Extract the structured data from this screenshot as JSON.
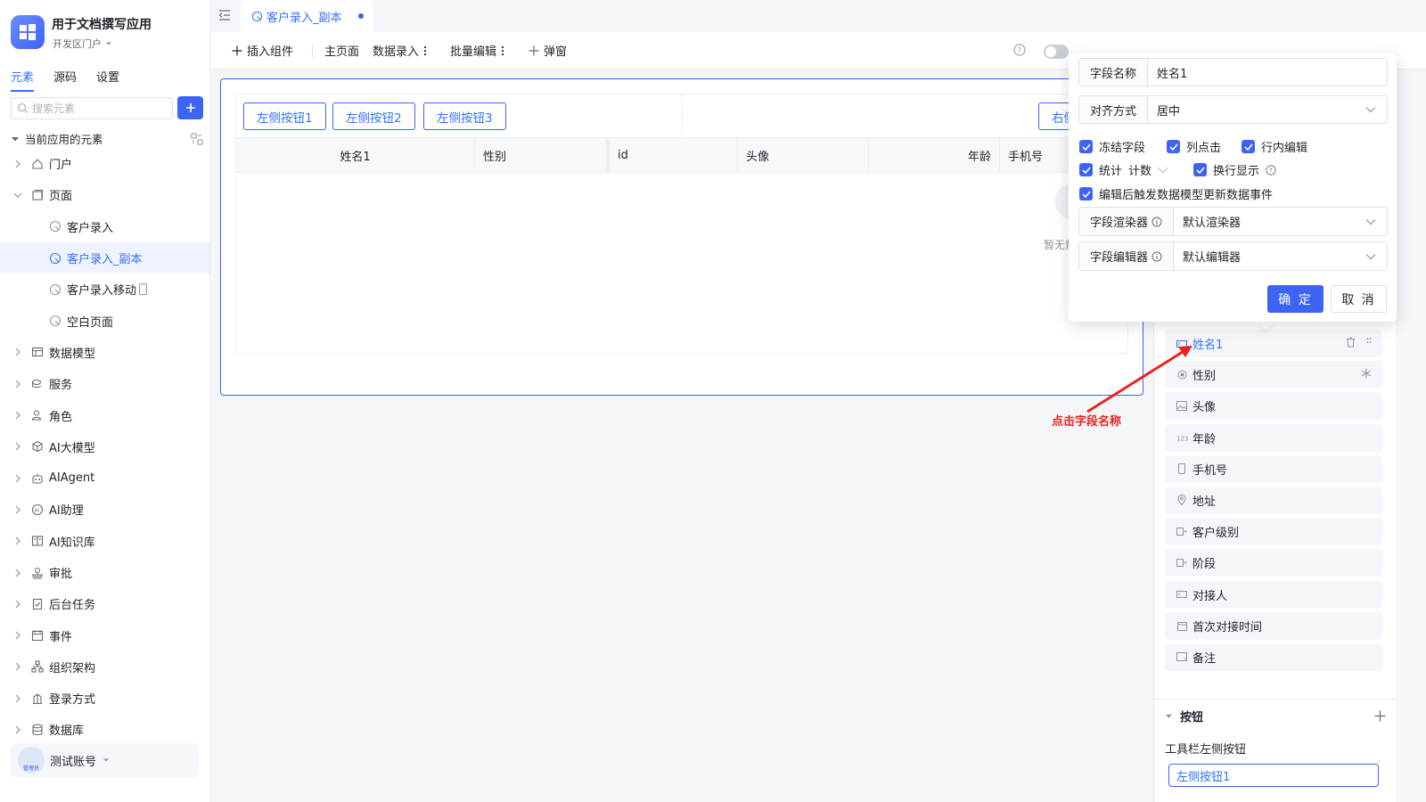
{
  "app": {
    "name": "用于文档撰写应用",
    "portal": "开发区门户"
  },
  "sidebar": {
    "tabs": [
      "元素",
      "源码",
      "设置"
    ],
    "search_placeholder": "搜索元素",
    "tree_header": "当前应用的元素",
    "items": [
      {
        "label": "门户",
        "icon": "home-icon"
      },
      {
        "label": "页面",
        "icon": "page-icon"
      },
      {
        "label": "客户录入",
        "icon": "page-link-icon"
      },
      {
        "label": "客户录入_副本",
        "icon": "page-link-icon"
      },
      {
        "label": "客户录入移动",
        "icon": "page-link-icon"
      },
      {
        "label": "空白页面",
        "icon": "page-link-icon"
      },
      {
        "label": "数据模型",
        "icon": "table-icon"
      },
      {
        "label": "服务",
        "icon": "service-icon"
      },
      {
        "label": "角色",
        "icon": "role-icon"
      },
      {
        "label": "AI大模型",
        "icon": "cube-icon"
      },
      {
        "label": "AIAgent",
        "icon": "robot-icon"
      },
      {
        "label": "AI助理",
        "icon": "ai-assistant-icon"
      },
      {
        "label": "AI知识库",
        "icon": "book-icon"
      },
      {
        "label": "审批",
        "icon": "stamp-icon"
      },
      {
        "label": "后台任务",
        "icon": "task-icon"
      },
      {
        "label": "事件",
        "icon": "event-icon"
      },
      {
        "label": "组织架构",
        "icon": "org-icon"
      },
      {
        "label": "登录方式",
        "icon": "login-icon"
      },
      {
        "label": "数据库",
        "icon": "database-icon"
      }
    ],
    "user": {
      "name": "测试账号",
      "role": "管理员"
    }
  },
  "tab_strip": {
    "active_tab": "客户录入_副本"
  },
  "toolbar": {
    "insert": "插入组件",
    "main_page": "主页面",
    "data_entry": "数据录入",
    "batch_edit": "批量编辑",
    "popup": "弹窗"
  },
  "canvas": {
    "left_buttons": [
      "左侧按钮1",
      "左侧按钮2",
      "左侧按钮3"
    ],
    "right_button": "右侧",
    "columns": [
      "姓名1",
      "性别",
      "id",
      "头像",
      "年龄",
      "手机号"
    ],
    "empty_text": "暂无数"
  },
  "popover": {
    "field_name_label": "字段名称",
    "field_name_value": "姓名1",
    "align_label": "对齐方式",
    "align_value": "居中",
    "checks": {
      "freeze": "冻结字段",
      "column_click": "列点击",
      "inline_edit": "行内编辑",
      "stats": "统计",
      "stats_value": "计数",
      "wrap": "换行显示",
      "trigger": "编辑后触发数据模型更新数据事件"
    },
    "renderer_label": "字段渲染器",
    "renderer_value": "默认渲染器",
    "editor_label": "字段编辑器",
    "editor_value": "默认编辑器",
    "ok": "确 定",
    "cancel": "取 消"
  },
  "fields": [
    {
      "label": "姓名1",
      "icon": "text-field-icon"
    },
    {
      "label": "性别",
      "icon": "radio-icon"
    },
    {
      "label": "头像",
      "icon": "image-icon"
    },
    {
      "label": "年龄",
      "icon": "number-icon"
    },
    {
      "label": "手机号",
      "icon": "phone-icon"
    },
    {
      "label": "地址",
      "icon": "location-icon"
    },
    {
      "label": "客户级别",
      "icon": "select-icon"
    },
    {
      "label": "阶段",
      "icon": "select-icon"
    },
    {
      "label": "对接人",
      "icon": "text-field-icon"
    },
    {
      "label": "首次对接时间",
      "icon": "date-icon"
    },
    {
      "label": "备注",
      "icon": "textarea-icon"
    }
  ],
  "buttons_section": {
    "title": "按钮",
    "toolbar_left_label": "工具栏左侧按钮",
    "toolbar_left_value": "左侧按钮1"
  },
  "annotation": {
    "text": "点击字段名称"
  },
  "colors": {
    "accent": "#3d63f5",
    "annotation": "#e8221e"
  }
}
